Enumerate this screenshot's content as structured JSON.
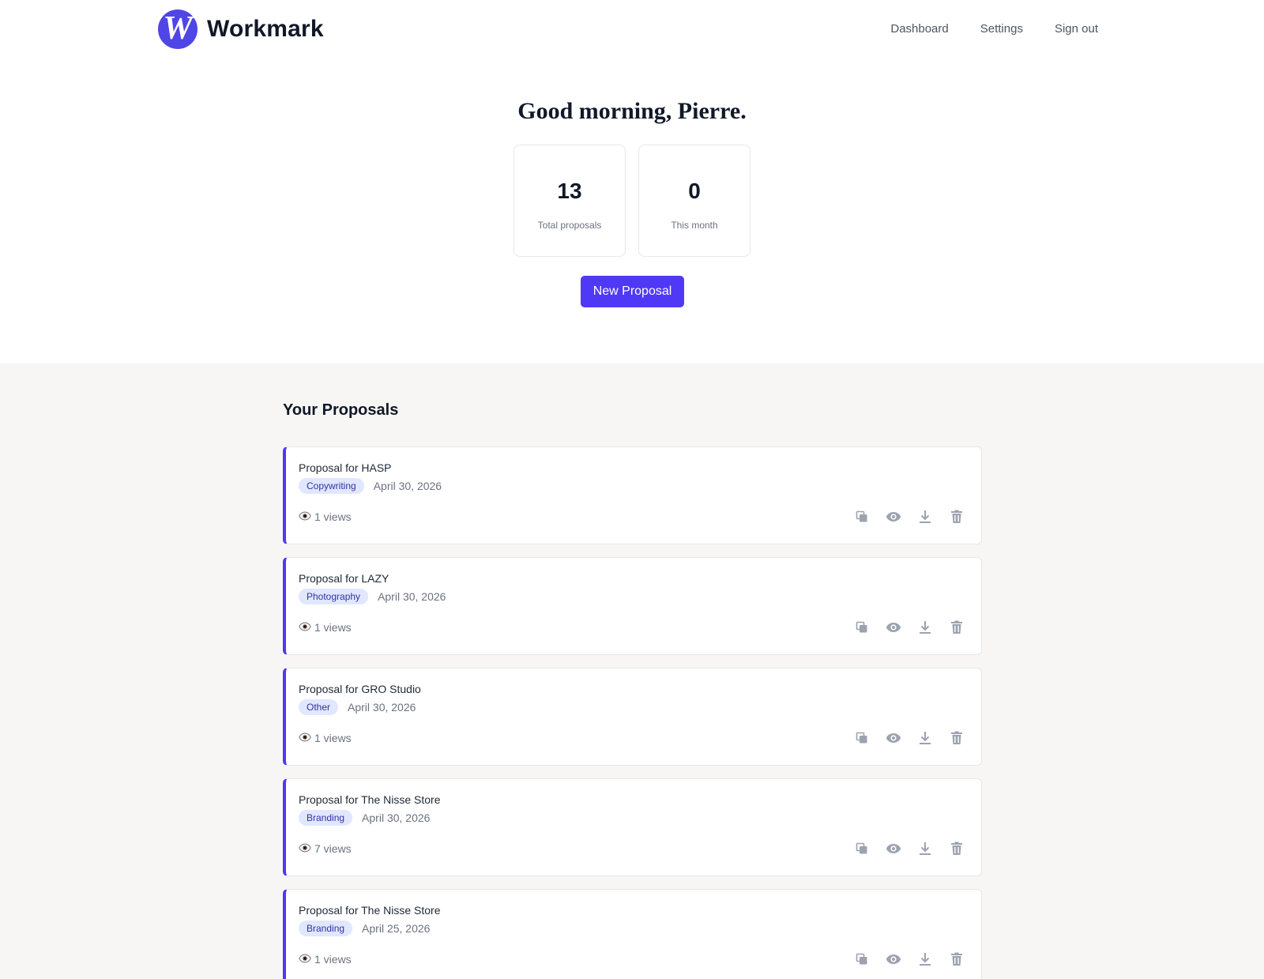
{
  "brand": {
    "logo_letter": "W",
    "name": "Workmark",
    "color": "#4f46e5"
  },
  "nav": {
    "dashboard": "Dashboard",
    "settings": "Settings",
    "signout": "Sign out"
  },
  "hero": {
    "greeting": "Good morning, Pierre.",
    "stats": [
      {
        "value": "13",
        "label": "Total proposals"
      },
      {
        "value": "0",
        "label": "This month"
      }
    ],
    "new_button": "New Proposal"
  },
  "proposals": {
    "title": "Your Proposals",
    "items": [
      {
        "title": "Proposal for HASP",
        "tag": "Copywriting",
        "date": "April 30, 2026",
        "views": "1 views"
      },
      {
        "title": "Proposal for LAZY",
        "tag": "Photography",
        "date": "April 30, 2026",
        "views": "1 views"
      },
      {
        "title": "Proposal for GRO Studio",
        "tag": "Other",
        "date": "April 30, 2026",
        "views": "1 views"
      },
      {
        "title": "Proposal for The Nisse Store",
        "tag": "Branding",
        "date": "April 30, 2026",
        "views": "7 views"
      },
      {
        "title": "Proposal for The Nisse Store",
        "tag": "Branding",
        "date": "April 25, 2026",
        "views": "1 views"
      }
    ]
  },
  "icons": {
    "views": "eye-icon",
    "duplicate": "copy-icon",
    "preview": "eye-icon",
    "download": "download-icon",
    "delete": "trash-icon"
  },
  "colors": {
    "accent": "#4f39f6",
    "tag_bg": "#e0e7ff",
    "tag_text": "#3730a3",
    "section_bg": "#f7f6f4"
  }
}
